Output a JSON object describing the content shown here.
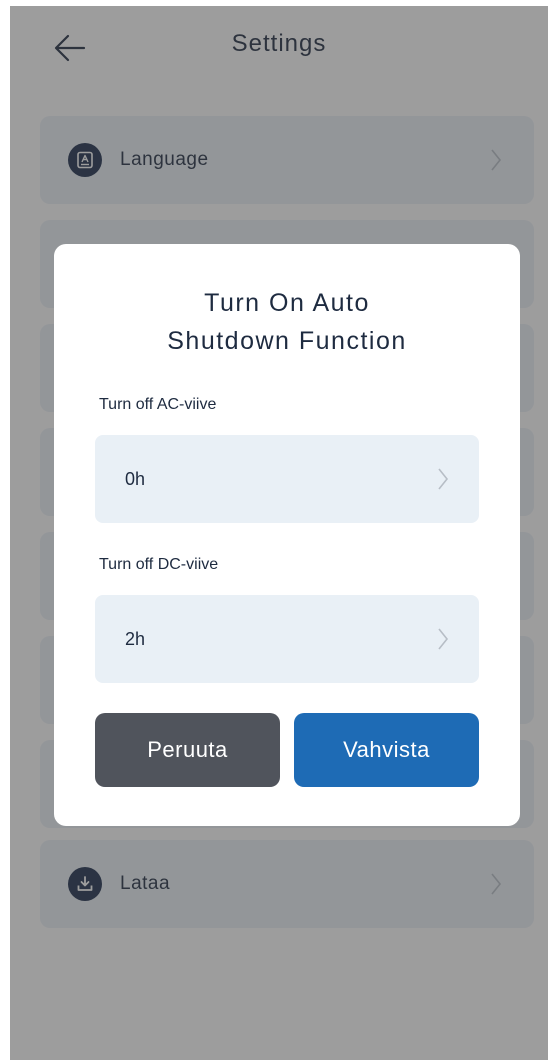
{
  "header": {
    "title": "Settings",
    "back_icon": "arrow-left-icon"
  },
  "menu": {
    "items": [
      {
        "label": "Language",
        "icon": "language-icon"
      },
      {
        "label": "",
        "icon": ""
      },
      {
        "label": "",
        "icon": ""
      },
      {
        "label": "",
        "icon": ""
      },
      {
        "label": "",
        "icon": ""
      },
      {
        "label": "",
        "icon": ""
      },
      {
        "label": "",
        "icon": ""
      },
      {
        "label": "Lataa",
        "icon": "download-icon"
      }
    ]
  },
  "dialog": {
    "title_line1": "Turn On Auto",
    "title_line2": "Shutdown Function",
    "ac_label": "Turn off AC-viive",
    "ac_value": "0h",
    "dc_label": "Turn off DC-viive",
    "dc_value": "2h",
    "cancel_label": "Peruuta",
    "confirm_label": "Vahvista"
  },
  "colors": {
    "primary": "#1e6bb5",
    "cancel": "#50545c",
    "icon_bg": "#1a2b4a",
    "field_bg": "#e9f0f6",
    "text": "#1e2b40"
  }
}
